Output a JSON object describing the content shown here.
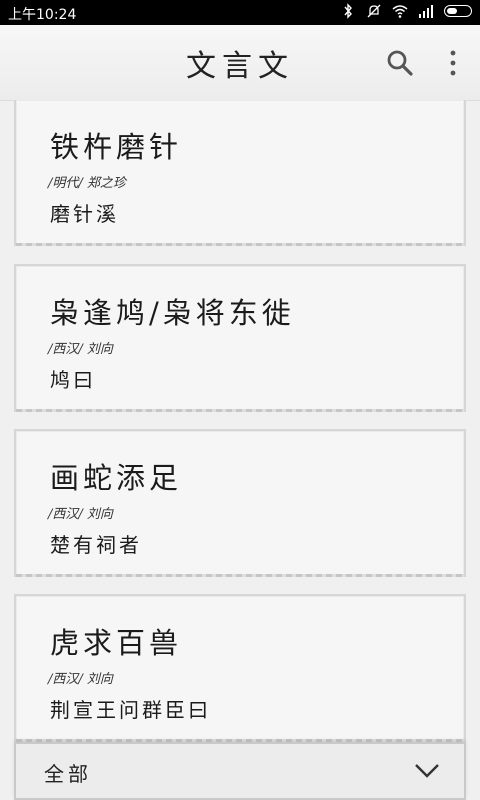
{
  "status_bar": {
    "time": "上午10:24"
  },
  "app_bar": {
    "title": "文言文"
  },
  "items": [
    {
      "title": "铁杵磨针",
      "author": "/明代/ 郑之珍",
      "excerpt": "磨针溪"
    },
    {
      "title": "枭逢鸠/枭将东徙",
      "author": "/西汉/ 刘向",
      "excerpt": "鸠曰"
    },
    {
      "title": "画蛇添足",
      "author": "/西汉/ 刘向",
      "excerpt": "楚有祠者"
    },
    {
      "title": "虎求百兽",
      "author": "/西汉/ 刘向",
      "excerpt": "荆宣王问群臣曰"
    }
  ],
  "filter": {
    "selected": "全部"
  },
  "icons": {
    "search": "search-icon",
    "menu": "more-vert-icon",
    "dropdown": "chevron-down-icon"
  }
}
